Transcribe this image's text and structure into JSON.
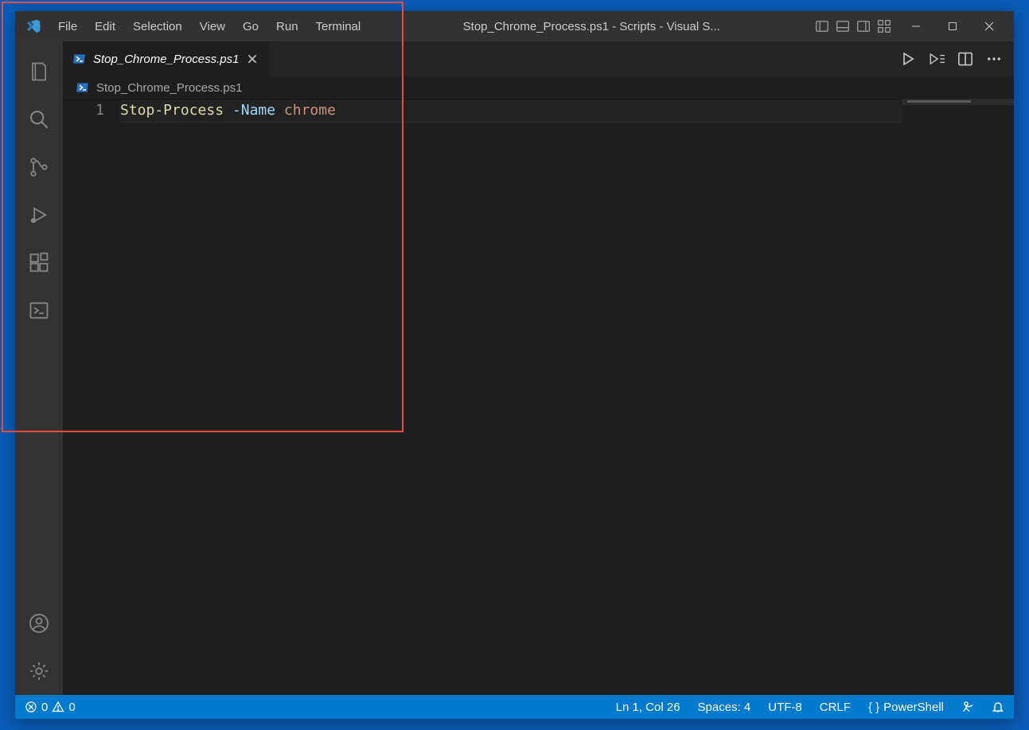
{
  "titlebar": {
    "menu": [
      "File",
      "Edit",
      "Selection",
      "View",
      "Go",
      "Run",
      "Terminal"
    ],
    "title": " Stop_Chrome_Process.ps1 - Scripts - Visual S..."
  },
  "tabs": {
    "active": {
      "label": "Stop_Chrome_Process.ps1"
    }
  },
  "breadcrumb": {
    "file": "Stop_Chrome_Process.ps1"
  },
  "editor": {
    "line_number": "1",
    "code": {
      "command": "Stop-Process",
      "param": "-Name",
      "argument": "chrome"
    }
  },
  "statusbar": {
    "errors": "0",
    "warnings": "0",
    "cursor": "Ln 1, Col 26",
    "indent": "Spaces: 4",
    "encoding": "UTF-8",
    "eol": "CRLF",
    "language": "PowerShell"
  }
}
